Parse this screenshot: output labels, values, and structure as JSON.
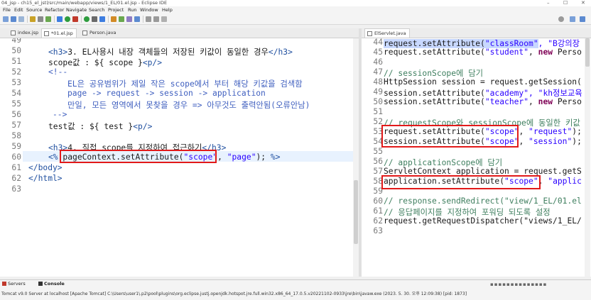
{
  "window": {
    "title": "04_jsp - ch15_el_jstl/src/main/webapp/views/1_EL/01.el.jsp - Eclipse IDE",
    "controls": [
      "–",
      "☐",
      "✕"
    ]
  },
  "menu": [
    "File",
    "Edit",
    "Source",
    "Refactor",
    "Navigate",
    "Search",
    "Project",
    "Run",
    "Window",
    "Help"
  ],
  "left_tabs": [
    {
      "label": "index.jsp",
      "active": false
    },
    {
      "label": "*01.el.jsp",
      "active": true
    },
    {
      "label": "Person.java",
      "active": false
    }
  ],
  "right_tabs": [
    {
      "label": "ElServlet.java",
      "active": true
    }
  ],
  "left_lines": [
    "49",
    "50",
    "51",
    "52",
    "53",
    "54",
    "55",
    "56",
    "57",
    "58",
    "59",
    "60",
    "61",
    "62",
    "63"
  ],
  "left_code": {
    "l50": {
      "open": "<h3>",
      "text": "3. EL사용시 내장 객체들의 저장된 키값이 동일한 경우",
      "close": "</h3>"
    },
    "l51": {
      "text": "scope값 : ${ scope }",
      "close": "<p/>"
    },
    "l52": "<!--",
    "l53": "EL은 공유범위가 제일 작은 scope에서 부터 해당 키값을 검색함",
    "l54": "page -> request -> session -> application",
    "l55": "만일, 모든 영역에서 못찾을 경우 => 아무것도 출력안됨(오류안남)",
    "l56": "-->",
    "l57": {
      "text": "test값 : ${ test }",
      "close": "<p/>"
    },
    "l59": {
      "open": "<h3>",
      "text": "4. 직접 scope를 지정하여 접근하기",
      "close": "</h3>"
    },
    "l60": {
      "open": "<%",
      "method": "pageContext.setAttribute(",
      "key": "\"scope\"",
      "rest_a": ", ",
      "value": "\"page\"",
      "rest_b": "); ",
      "close": "%>"
    },
    "l61": "</body>",
    "l62": "</html>"
  },
  "right_lines": [
    "44",
    "45",
    "46",
    "47",
    "48",
    "49",
    "50",
    "51",
    "52",
    "53",
    "54",
    "55",
    "56",
    "57",
    "58",
    "59",
    "60",
    "61",
    "62",
    "63"
  ],
  "right_code": {
    "l44": {
      "call": "request.setAttribute(",
      "arg": "\"classRoom\"",
      "rest": ", \"B강의장"
    },
    "l45": {
      "call": "request.setAttribute(",
      "arg": "\"student\"",
      "rest": ", ",
      "kw": "new",
      "tail": " Perso"
    },
    "l47": "// sessionScope에 담기",
    "l48": {
      "text": "HttpSession session = request.getSession("
    },
    "l49": {
      "call": "session.setAttribute(",
      "arg": "\"academy\"",
      "rest": ", \"kh정보교육"
    },
    "l50": {
      "call": "session.setAttribute(",
      "arg": "\"teacher\"",
      "rest": ", ",
      "kw": "new",
      "tail": " Perso"
    },
    "l52": "// requestScope와 sessionScope에 동일한 키값",
    "l53": {
      "call": "request.setAttribute(",
      "arg": "\"scope\"",
      "rest": ", ",
      "val": "\"request\"",
      "tail": ");"
    },
    "l54": {
      "call": "session.setAttribute(",
      "arg": "\"scope\"",
      "rest": ", ",
      "val": "\"session\"",
      "tail": ");"
    },
    "l56": "// applicationScope에 담기",
    "l57": {
      "text": "ServletContext application = request.getS"
    },
    "l58": {
      "call": "application.setAttribute(",
      "arg": "\"scope\"",
      "rest": ", ",
      "val": "\"applic"
    },
    "l60": "// response.sendRedirect(\"view/1_EL/01.el",
    "l61": "// 응답페이지를 지정하여 포워딩 되도록 설정",
    "l62": {
      "text": "request.getRequestDispatcher(\"views/1_EL/"
    }
  },
  "bottom": {
    "tabs": [
      "Servers",
      "Console"
    ],
    "console_text": "Tomcat v9.0 Server at localhost [Apache Tomcat] C:\\Users\\user1\\.p2\\pool\\plugins\\org.eclipse.justj.openjdk.hotspot.jre.full.win32.x86_64_17.0.5.v20221102-0933\\jre\\bin\\javaw.exe  (2023. 5. 30. 오후 12:09:38) [pid: 1873]"
  },
  "colors": {
    "highlight": "#e21a1a",
    "tag": "#1f4f9f",
    "string": "#2a00ff",
    "comment": "#3f7f5f",
    "keyword": "#7f0055"
  }
}
